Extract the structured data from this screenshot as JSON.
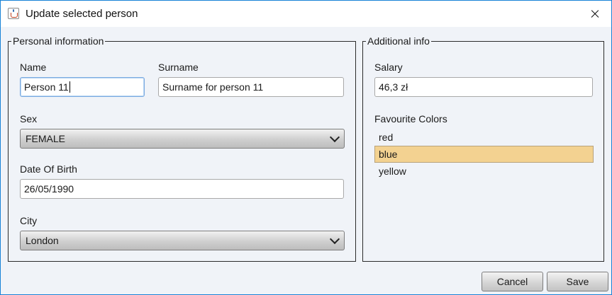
{
  "window": {
    "title": "Update selected person"
  },
  "personal": {
    "legend": "Personal information",
    "name_label": "Name",
    "name_value": "Person 11",
    "surname_label": "Surname",
    "surname_value": "Surname for person 11",
    "sex_label": "Sex",
    "sex_value": "FEMALE",
    "dob_label": "Date Of Birth",
    "dob_value": "26/05/1990",
    "city_label": "City",
    "city_value": "London"
  },
  "additional": {
    "legend": "Additional info",
    "salary_label": "Salary",
    "salary_value": "46,3 zł",
    "colors_label": "Favourite Colors",
    "colors": [
      "red",
      "blue",
      "yellow"
    ],
    "selected_color": "blue"
  },
  "buttons": {
    "cancel": "Cancel",
    "save": "Save"
  },
  "icons": {
    "app": "java-cup-icon",
    "close": "close-icon",
    "dropdown": "chevron-down-icon"
  },
  "theme": {
    "selection_color": "#f3d291",
    "window_border": "#1883d7"
  }
}
